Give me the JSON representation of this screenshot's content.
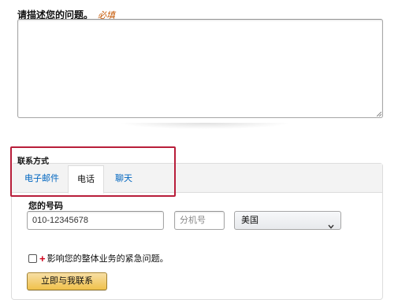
{
  "problem": {
    "label": "请描述您的问题。",
    "required_text": "必填"
  },
  "contact": {
    "title": "联系方式",
    "tabs": [
      {
        "label": "电子邮件",
        "selected": false
      },
      {
        "label": "电话",
        "selected": true
      },
      {
        "label": "聊天",
        "selected": false
      }
    ],
    "phone_label": "您的号码",
    "phone_value": "010-12345678",
    "ext_placeholder": "分机号",
    "country_selected": "美国",
    "urgent_text": "影响您的整体业务的紧急问题。",
    "call_button": "立即与我联系"
  },
  "colors": {
    "highlight_border": "#b81e3a",
    "link_blue": "#0066c0",
    "button_gold": "#f0c14b",
    "required_orange": "#c45500",
    "plus_red": "#d0021b"
  }
}
